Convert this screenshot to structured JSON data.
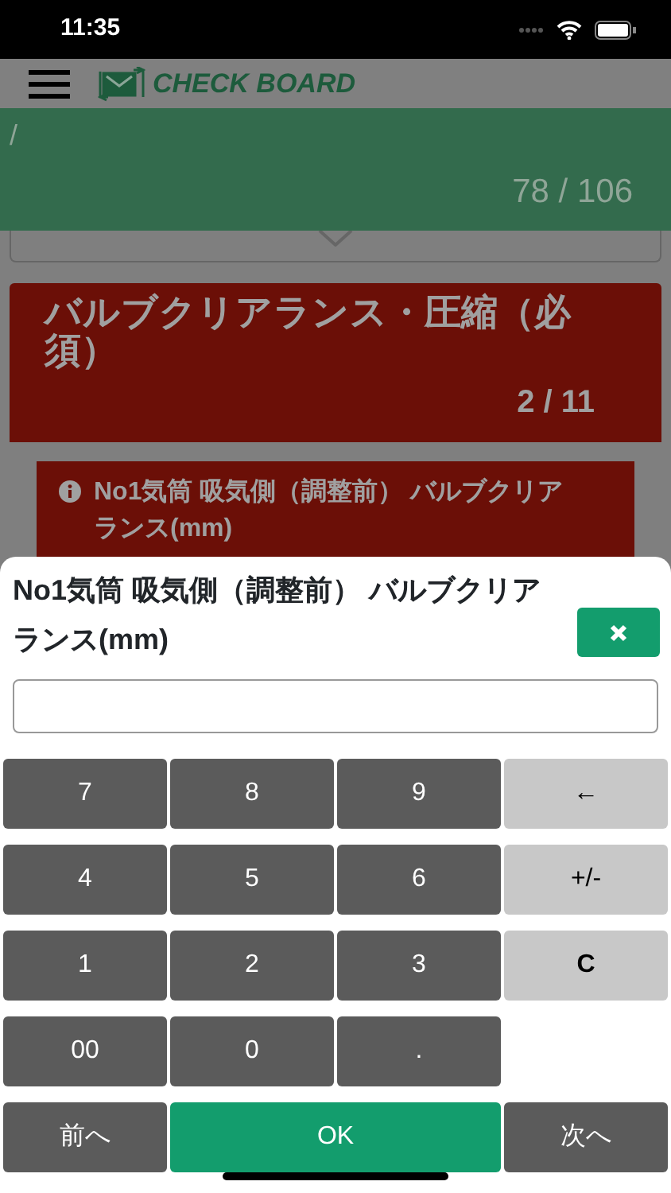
{
  "status_bar": {
    "time": "11:35"
  },
  "header": {
    "title": "CHECK BOARD"
  },
  "progress_banner": {
    "text": "/",
    "count": "78 / 106"
  },
  "section": {
    "title": "バルブクリアランス・圧縮（必須）",
    "count": "2 / 11",
    "item": "No1気筒 吸気側（調整前） バルブクリアランス(mm)"
  },
  "keypad": {
    "title": "No1気筒 吸気側（調整前） バルブクリアランス(mm)",
    "rows": [
      [
        {
          "label": "7",
          "kind": "digit"
        },
        {
          "label": "8",
          "kind": "digit"
        },
        {
          "label": "9",
          "kind": "digit"
        },
        {
          "label": "←",
          "kind": "function"
        }
      ],
      [
        {
          "label": "4",
          "kind": "digit"
        },
        {
          "label": "5",
          "kind": "digit"
        },
        {
          "label": "6",
          "kind": "digit"
        },
        {
          "label": "+/-",
          "kind": "function"
        }
      ],
      [
        {
          "label": "1",
          "kind": "digit"
        },
        {
          "label": "2",
          "kind": "digit"
        },
        {
          "label": "3",
          "kind": "digit"
        },
        {
          "label": "C",
          "kind": "function"
        }
      ],
      [
        {
          "label": "00",
          "kind": "digit"
        },
        {
          "label": "0",
          "kind": "digit"
        },
        {
          "label": ".",
          "kind": "digit"
        }
      ],
      [
        {
          "label": "前へ",
          "kind": "digit"
        },
        {
          "label": "OK",
          "kind": "ok",
          "colspan": 2
        },
        {
          "label": "次へ",
          "kind": "digit"
        }
      ]
    ]
  }
}
